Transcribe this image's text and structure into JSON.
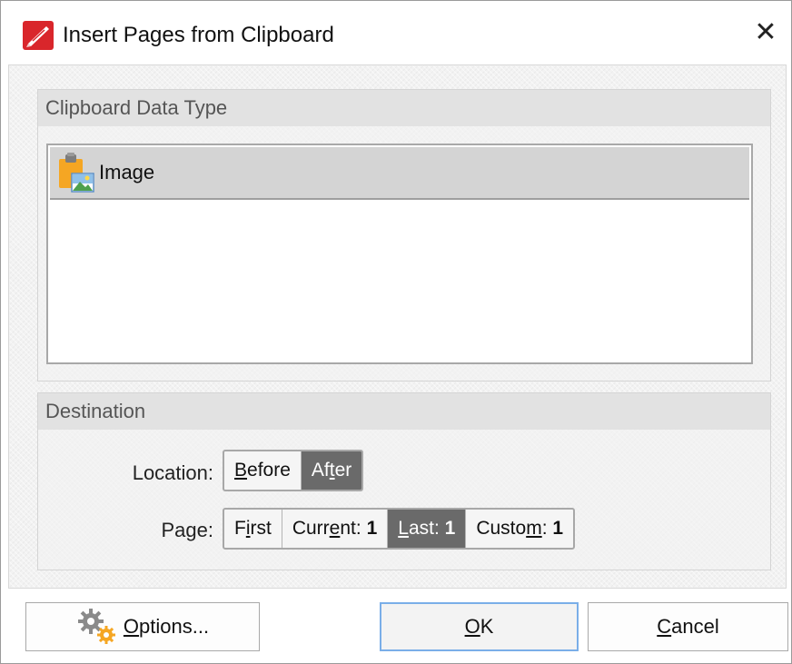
{
  "window": {
    "title": "Insert Pages from Clipboard",
    "close_glyph": "✕"
  },
  "data_type": {
    "header": "Clipboard Data Type",
    "items": [
      {
        "label": "Image",
        "icon": "clipboard-image-icon",
        "selected": true
      }
    ]
  },
  "destination": {
    "header": "Destination",
    "location_label": "Location:",
    "location_options": [
      {
        "pre": "",
        "mnemonic": "B",
        "post": "efore",
        "selected": false
      },
      {
        "pre": "Af",
        "mnemonic": "t",
        "post": "er",
        "selected": true
      }
    ],
    "page_label": "Page:",
    "page_options": [
      {
        "pre": "F",
        "mnemonic": "i",
        "post": "rst",
        "value": "",
        "selected": false
      },
      {
        "pre": "Curr",
        "mnemonic": "e",
        "post": "nt:",
        "value": "1",
        "selected": false
      },
      {
        "pre": "",
        "mnemonic": "L",
        "post": "ast:",
        "value": "1",
        "selected": true
      },
      {
        "pre": "Custo",
        "mnemonic": "m",
        "post": ":",
        "value": "1",
        "selected": false
      }
    ]
  },
  "buttons": {
    "options": {
      "pre": "",
      "mnemonic": "O",
      "post": "ptions..."
    },
    "ok": {
      "pre": "",
      "mnemonic": "O",
      "post": "K"
    },
    "cancel": {
      "pre": "",
      "mnemonic": "C",
      "post": "ancel"
    }
  },
  "colors": {
    "selected_segment": "#6a6a6a",
    "default_button_border": "#7aaee8",
    "app_icon_red": "#d9262b"
  }
}
